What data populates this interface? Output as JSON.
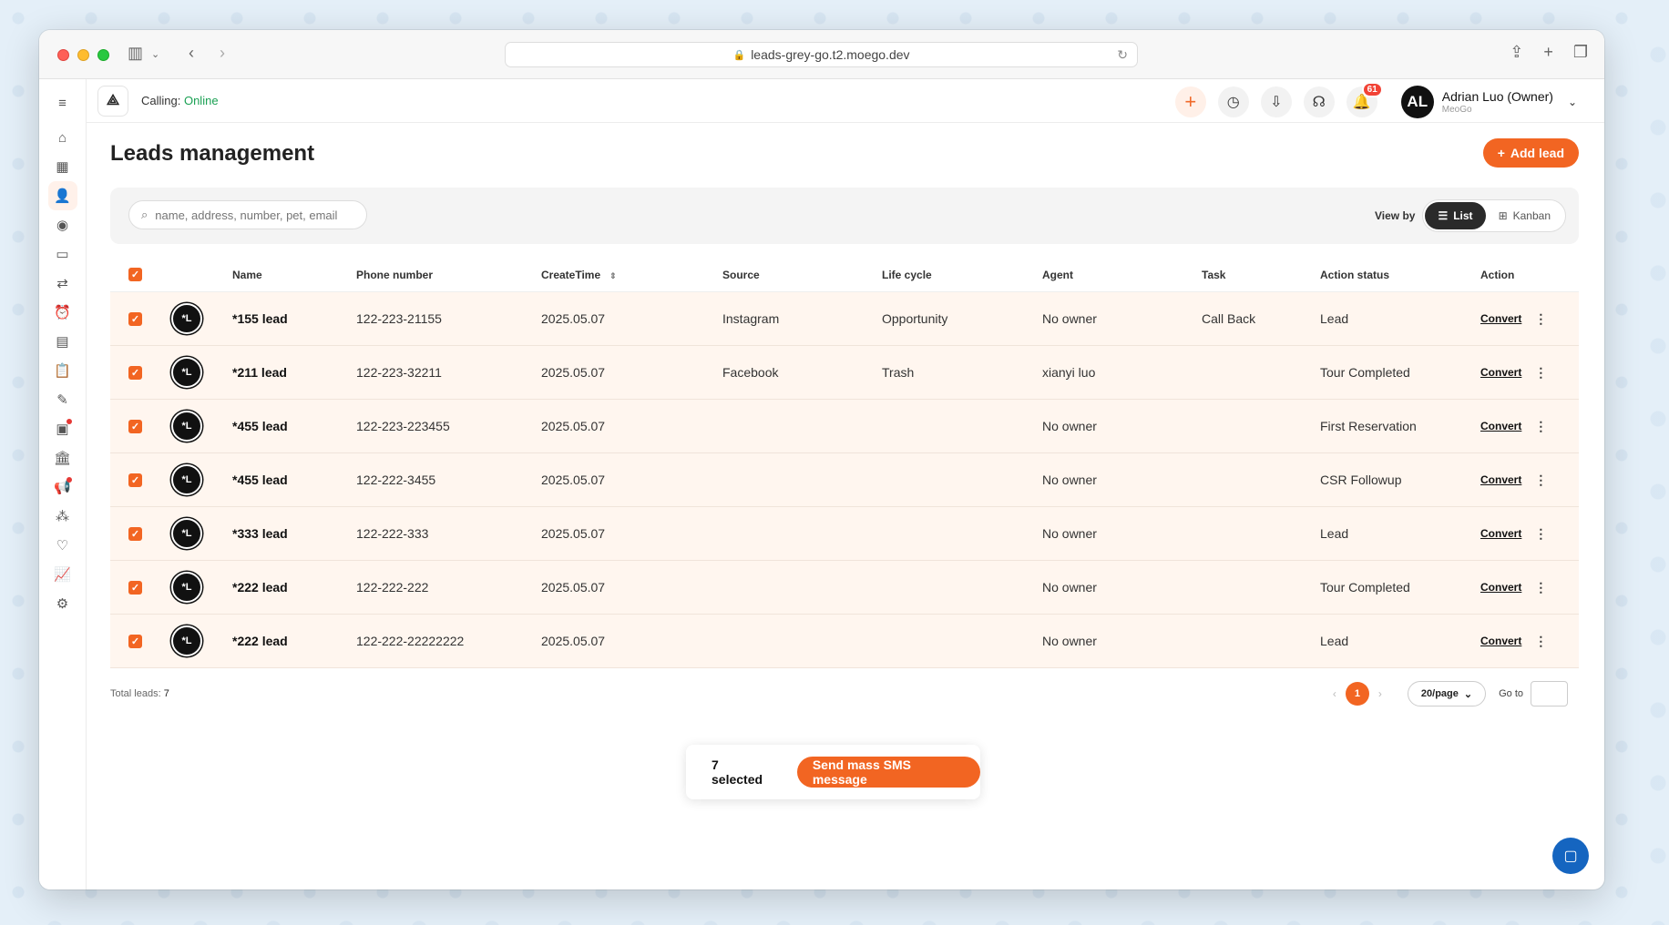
{
  "browser": {
    "url": "leads-grey-go.t2.moego.dev"
  },
  "appbar": {
    "calling_label": "Calling: ",
    "calling_status": "Online",
    "notification_count": "61",
    "user_initials": "AL",
    "user_name": "Adrian Luo (Owner)",
    "user_org": "MeoGo"
  },
  "page": {
    "title": "Leads management",
    "add_lead_label": "Add lead"
  },
  "filters": {
    "search_placeholder": "name, address, number, pet, email",
    "view_by_label": "View by",
    "view_list": "List",
    "view_kanban": "Kanban"
  },
  "table": {
    "headers": {
      "name": "Name",
      "phone": "Phone number",
      "create_time": "CreateTime",
      "source": "Source",
      "life_cycle": "Life cycle",
      "agent": "Agent",
      "task": "Task",
      "action_status": "Action status",
      "action": "Action"
    },
    "rows": [
      {
        "avatar": "*L",
        "name": "*155 lead",
        "phone": "122-223-21155",
        "create_time": "2025.05.07",
        "source": "Instagram",
        "life_cycle": "Opportunity",
        "agent": "No owner",
        "task": "Call Back",
        "action_status": "Lead",
        "action": "Convert"
      },
      {
        "avatar": "*L",
        "name": "*211 lead",
        "phone": "122-223-32211",
        "create_time": "2025.05.07",
        "source": "Facebook",
        "life_cycle": "Trash",
        "agent": "xianyi luo",
        "task": "",
        "action_status": "Tour Completed",
        "action": "Convert"
      },
      {
        "avatar": "*L",
        "name": "*455 lead",
        "phone": "122-223-223455",
        "create_time": "2025.05.07",
        "source": "",
        "life_cycle": "",
        "agent": "No owner",
        "task": "",
        "action_status": "First Reservation",
        "action": "Convert"
      },
      {
        "avatar": "*L",
        "name": "*455 lead",
        "phone": "122-222-3455",
        "create_time": "2025.05.07",
        "source": "",
        "life_cycle": "",
        "agent": "No owner",
        "task": "",
        "action_status": "CSR Followup",
        "action": "Convert"
      },
      {
        "avatar": "*L",
        "name": "*333 lead",
        "phone": "122-222-333",
        "create_time": "2025.05.07",
        "source": "",
        "life_cycle": "",
        "agent": "No owner",
        "task": "",
        "action_status": "Lead",
        "action": "Convert"
      },
      {
        "avatar": "*L",
        "name": "*222 lead",
        "phone": "122-222-222",
        "create_time": "2025.05.07",
        "source": "",
        "life_cycle": "",
        "agent": "No owner",
        "task": "",
        "action_status": "Tour Completed",
        "action": "Convert"
      },
      {
        "avatar": "*L",
        "name": "*222 lead",
        "phone": "122-222-22222222",
        "create_time": "2025.05.07",
        "source": "",
        "life_cycle": "",
        "agent": "No owner",
        "task": "",
        "action_status": "Lead",
        "action": "Convert"
      }
    ]
  },
  "pagination": {
    "total_label": "Total leads: ",
    "total_count": "7",
    "current_page": "1",
    "per_page": "20/page",
    "goto_label": "Go to"
  },
  "bulk_bar": {
    "selected_label": "7 selected",
    "action_label": "Send mass SMS message"
  },
  "colors": {
    "accent": "#f26522",
    "online": "#1aa053",
    "row_selected": "#fff6ef"
  }
}
